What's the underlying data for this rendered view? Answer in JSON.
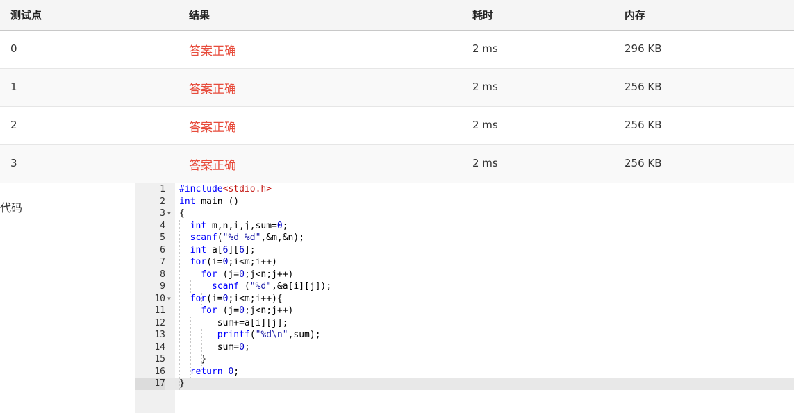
{
  "table": {
    "headers": [
      "测试点",
      "结果",
      "耗时",
      "内存"
    ],
    "rows": [
      {
        "point": "0",
        "result": "答案正确",
        "time": "2 ms",
        "memory": "296 KB"
      },
      {
        "point": "1",
        "result": "答案正确",
        "time": "2 ms",
        "memory": "256 KB"
      },
      {
        "point": "2",
        "result": "答案正确",
        "time": "2 ms",
        "memory": "256 KB"
      },
      {
        "point": "3",
        "result": "答案正确",
        "time": "2 ms",
        "memory": "256 KB"
      }
    ],
    "result_color": "#e74c3c"
  },
  "code_section": {
    "label": "代码",
    "active_line": 17,
    "folded_lines": [
      3,
      10
    ],
    "lines": [
      "#include<stdio.h>",
      "int main ()",
      "{",
      "  int m,n,i,j,sum=0;",
      "  scanf(\"%d %d\",&m,&n);",
      "  int a[6][6];",
      "  for(i=0;i<m;i++)",
      "    for (j=0;j<n;j++)",
      "      scanf (\"%d\",&a[i][j]);",
      "  for(i=0;i<m;i++){",
      "    for (j=0;j<n;j++)",
      "       sum+=a[i][j];",
      "       printf(\"%d\\n\",sum);",
      "       sum=0;",
      "    }",
      "  return 0;",
      "}"
    ]
  }
}
